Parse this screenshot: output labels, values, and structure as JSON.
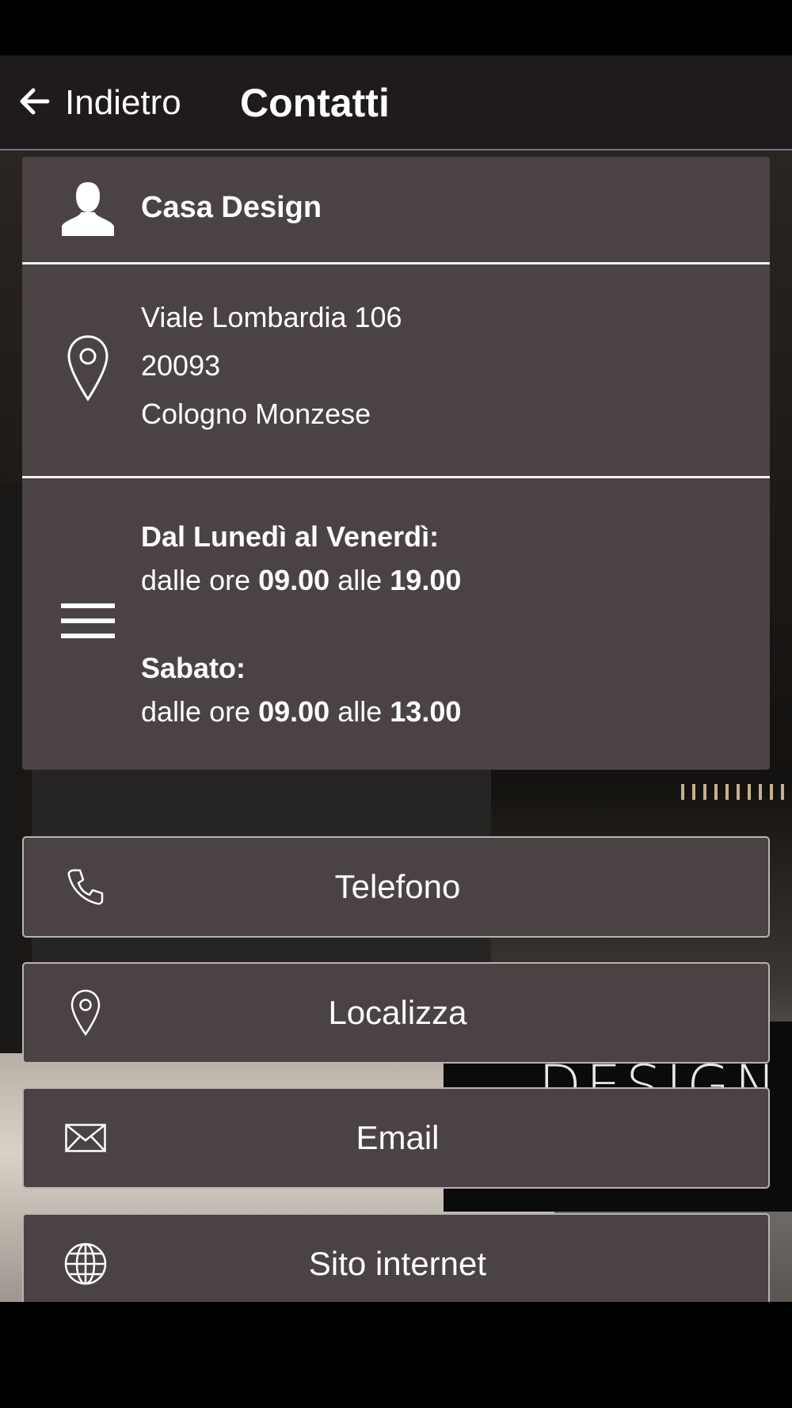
{
  "header": {
    "back_label": "Indietro",
    "title": "Contatti"
  },
  "background": {
    "sign_text": "DESIGN"
  },
  "contact_card": {
    "name": "Casa Design",
    "address": {
      "street": "Viale Lombardia 106",
      "postal_code": "20093",
      "city": "Cologno Monzese"
    },
    "hours": {
      "weekday_label": "Dal Lunedì al Venerdì:",
      "weekday_prefix": "dalle ore",
      "weekday_open": "09.00",
      "weekday_mid": "alle",
      "weekday_close": "19.00",
      "saturday_label": "Sabato:",
      "saturday_prefix": "dalle ore",
      "saturday_open": "09.00",
      "saturday_mid": "alle",
      "saturday_close": "13.00"
    }
  },
  "actions": [
    {
      "label": "Telefono",
      "icon": "phone-icon"
    },
    {
      "label": "Localizza",
      "icon": "map-pin-icon"
    },
    {
      "label": "Email",
      "icon": "envelope-icon"
    },
    {
      "label": "Sito internet",
      "icon": "globe-icon"
    }
  ],
  "colors": {
    "card_background": "#4b4343",
    "app_bar": "#1e1a1e",
    "text": "#ffffff"
  }
}
